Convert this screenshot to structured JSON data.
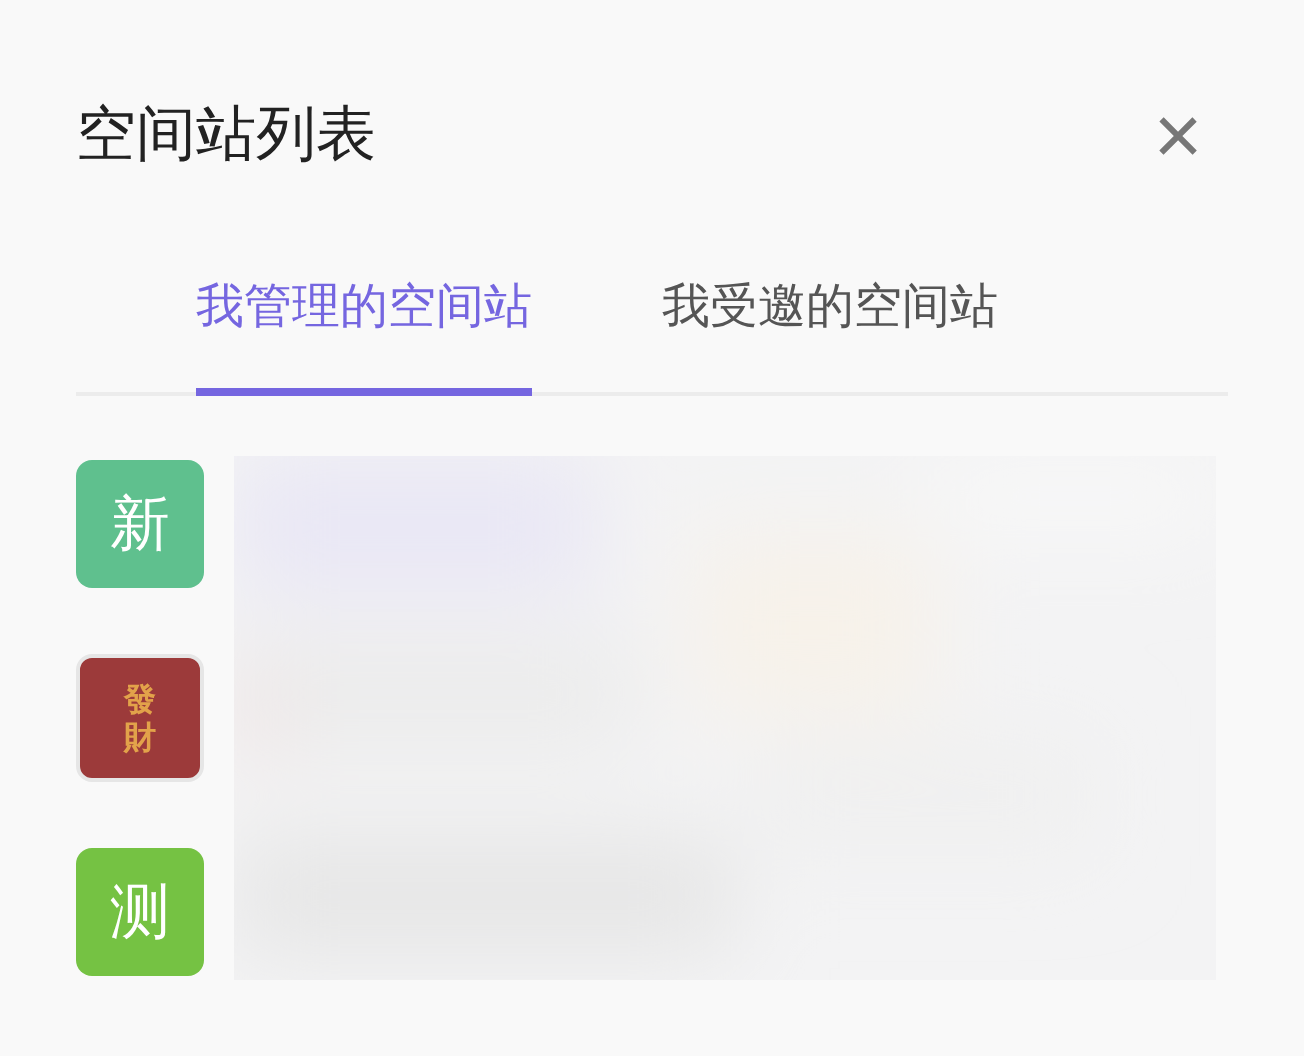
{
  "dialog": {
    "title": "空间站列表",
    "close": "×"
  },
  "tabs": [
    {
      "label": "我管理的空间站",
      "selected": true
    },
    {
      "label": "我受邀的空间站",
      "selected": false
    }
  ],
  "stations": [
    {
      "avatar": "新",
      "kind": "letter",
      "color": "#5fc08e"
    },
    {
      "avatar": "發財",
      "kind": "emblem",
      "color": "#9c3a3a"
    },
    {
      "avatar": "测",
      "kind": "letter",
      "color": "#75c243"
    }
  ]
}
